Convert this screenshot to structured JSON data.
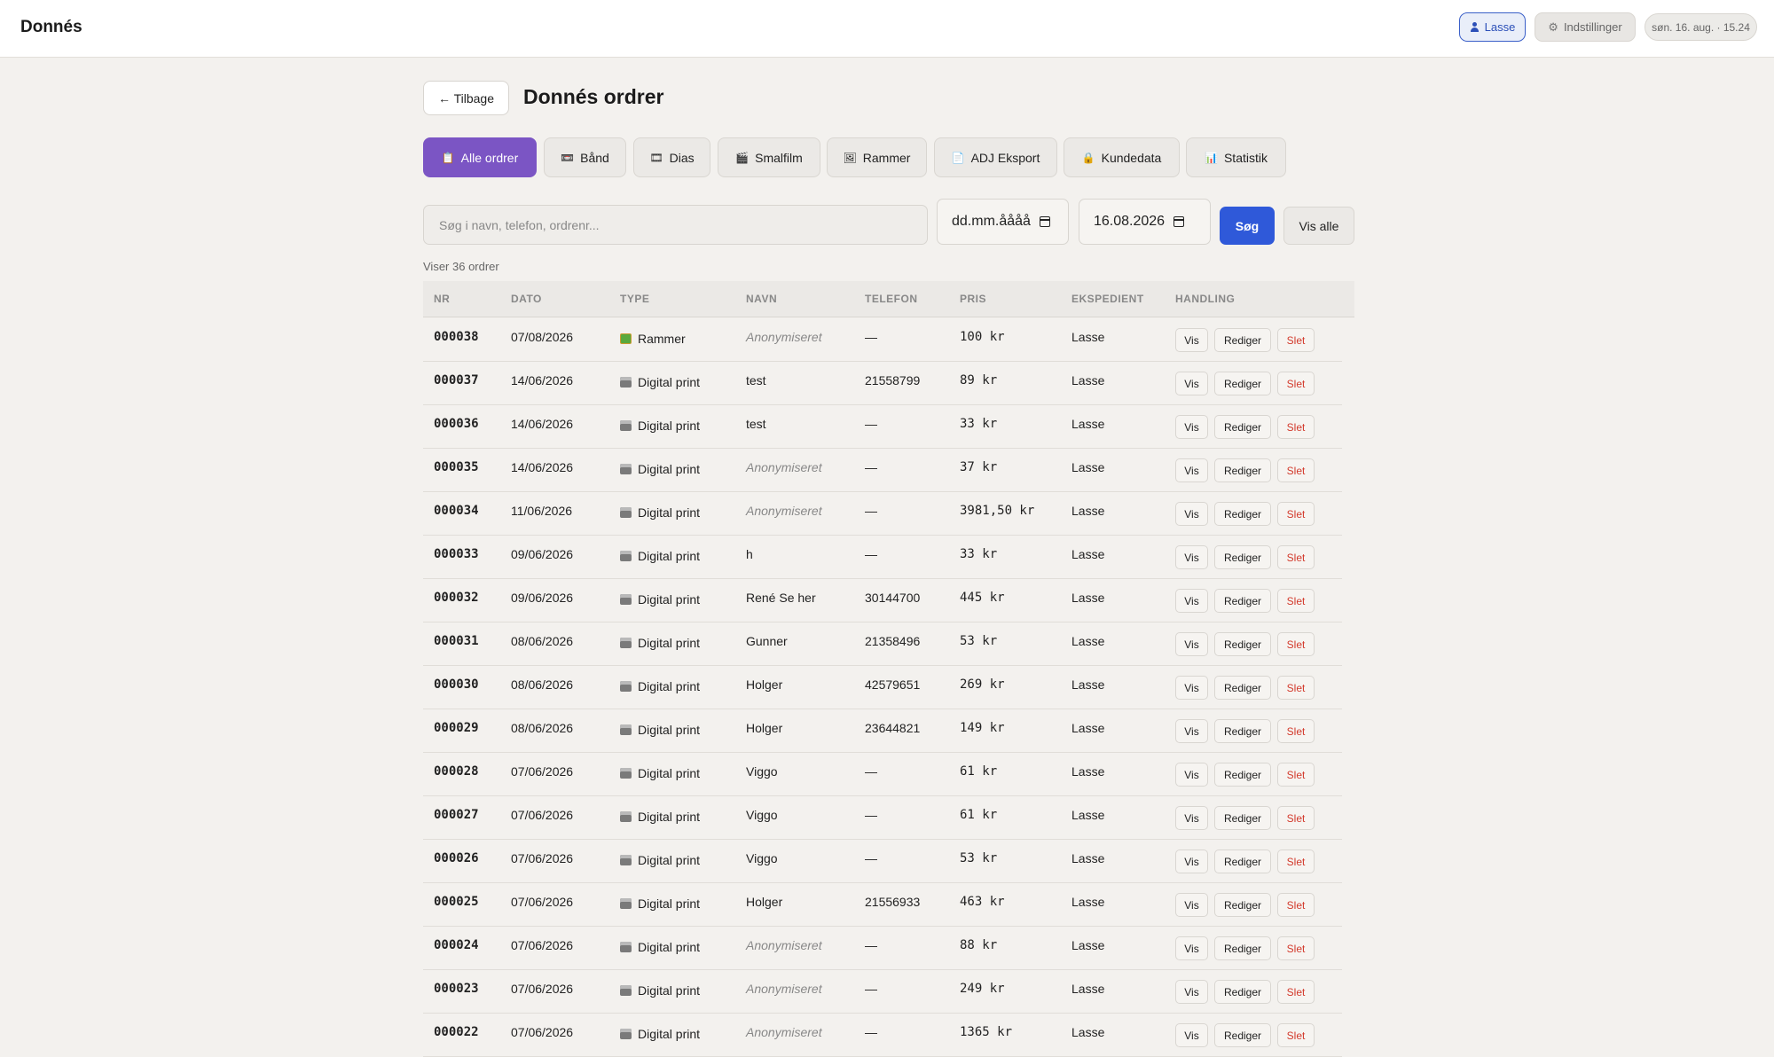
{
  "app": {
    "brand": "Donnés"
  },
  "topbar": {
    "user_label": "Lasse",
    "settings_label": "Indstillinger",
    "datetime": "søn. 16. aug. · 15.24"
  },
  "header": {
    "back_label": "← Tilbage",
    "title": "Donnés ordrer"
  },
  "tabs": [
    {
      "label": "Alle ordrer",
      "icon": "clipboard-icon",
      "active": true
    },
    {
      "label": "Bånd",
      "icon": "tape-icon"
    },
    {
      "label": "Dias",
      "icon": "slides-icon"
    },
    {
      "label": "Smalfilm",
      "icon": "film-icon"
    },
    {
      "label": "Rammer",
      "icon": "frame-icon"
    },
    {
      "label": "ADJ Eksport",
      "icon": "document-icon"
    },
    {
      "label": "Kundedata",
      "icon": "lock-icon"
    },
    {
      "label": "Statistik",
      "icon": "chart-icon"
    }
  ],
  "filters": {
    "search_placeholder": "Søg i navn, telefon, ordrenr...",
    "date_from": "dd.mm.åååå",
    "date_to": "16.08.2026",
    "search_button": "Søg",
    "show_all_button": "Vis alle"
  },
  "count_text": "Viser 36 ordrer",
  "table": {
    "headers": [
      "NR",
      "DATO",
      "TYPE",
      "NAVN",
      "TELEFON",
      "PRIS",
      "EKSPEDIENT",
      "HANDLING"
    ],
    "actions": {
      "view": "Vis",
      "edit": "Rediger",
      "delete": "Slet"
    },
    "rows": [
      {
        "nr": "000038",
        "date": "07/08/2026",
        "type": "Rammer",
        "name": "Anonymiseret",
        "phone": "—",
        "price": "100 kr",
        "clerk": "Lasse"
      },
      {
        "nr": "000037",
        "date": "14/06/2026",
        "type": "Digital print",
        "name": "test",
        "phone": "21558799",
        "price": "89 kr",
        "clerk": "Lasse"
      },
      {
        "nr": "000036",
        "date": "14/06/2026",
        "type": "Digital print",
        "name": "test",
        "phone": "—",
        "price": "33 kr",
        "clerk": "Lasse"
      },
      {
        "nr": "000035",
        "date": "14/06/2026",
        "type": "Digital print",
        "name": "Anonymiseret",
        "phone": "—",
        "price": "37 kr",
        "clerk": "Lasse"
      },
      {
        "nr": "000034",
        "date": "11/06/2026",
        "type": "Digital print",
        "name": "Anonymiseret",
        "phone": "—",
        "price": "3981,50 kr",
        "clerk": "Lasse"
      },
      {
        "nr": "000033",
        "date": "09/06/2026",
        "type": "Digital print",
        "name": "h",
        "phone": "—",
        "price": "33 kr",
        "clerk": "Lasse"
      },
      {
        "nr": "000032",
        "date": "09/06/2026",
        "type": "Digital print",
        "name": "René Se her",
        "phone": "30144700",
        "price": "445 kr",
        "clerk": "Lasse"
      },
      {
        "nr": "000031",
        "date": "08/06/2026",
        "type": "Digital print",
        "name": "Gunner",
        "phone": "21358496",
        "price": "53 kr",
        "clerk": "Lasse"
      },
      {
        "nr": "000030",
        "date": "08/06/2026",
        "type": "Digital print",
        "name": "Holger",
        "phone": "42579651",
        "price": "269 kr",
        "clerk": "Lasse"
      },
      {
        "nr": "000029",
        "date": "08/06/2026",
        "type": "Digital print",
        "name": "Holger",
        "phone": "23644821",
        "price": "149 kr",
        "clerk": "Lasse"
      },
      {
        "nr": "000028",
        "date": "07/06/2026",
        "type": "Digital print",
        "name": "Viggo",
        "phone": "—",
        "price": "61 kr",
        "clerk": "Lasse"
      },
      {
        "nr": "000027",
        "date": "07/06/2026",
        "type": "Digital print",
        "name": "Viggo",
        "phone": "—",
        "price": "61 kr",
        "clerk": "Lasse"
      },
      {
        "nr": "000026",
        "date": "07/06/2026",
        "type": "Digital print",
        "name": "Viggo",
        "phone": "—",
        "price": "53 kr",
        "clerk": "Lasse"
      },
      {
        "nr": "000025",
        "date": "07/06/2026",
        "type": "Digital print",
        "name": "Holger",
        "phone": "21556933",
        "price": "463 kr",
        "clerk": "Lasse"
      },
      {
        "nr": "000024",
        "date": "07/06/2026",
        "type": "Digital print",
        "name": "Anonymiseret",
        "phone": "—",
        "price": "88 kr",
        "clerk": "Lasse"
      },
      {
        "nr": "000023",
        "date": "07/06/2026",
        "type": "Digital print",
        "name": "Anonymiseret",
        "phone": "—",
        "price": "249 kr",
        "clerk": "Lasse"
      },
      {
        "nr": "000022",
        "date": "07/06/2026",
        "type": "Digital print",
        "name": "Anonymiseret",
        "phone": "—",
        "price": "1365 kr",
        "clerk": "Lasse"
      }
    ]
  },
  "colors": {
    "accent_purple": "#7b55c4",
    "accent_blue": "#2f59d9",
    "delete_red": "#d33a2c",
    "background": "#f3f1ee"
  }
}
